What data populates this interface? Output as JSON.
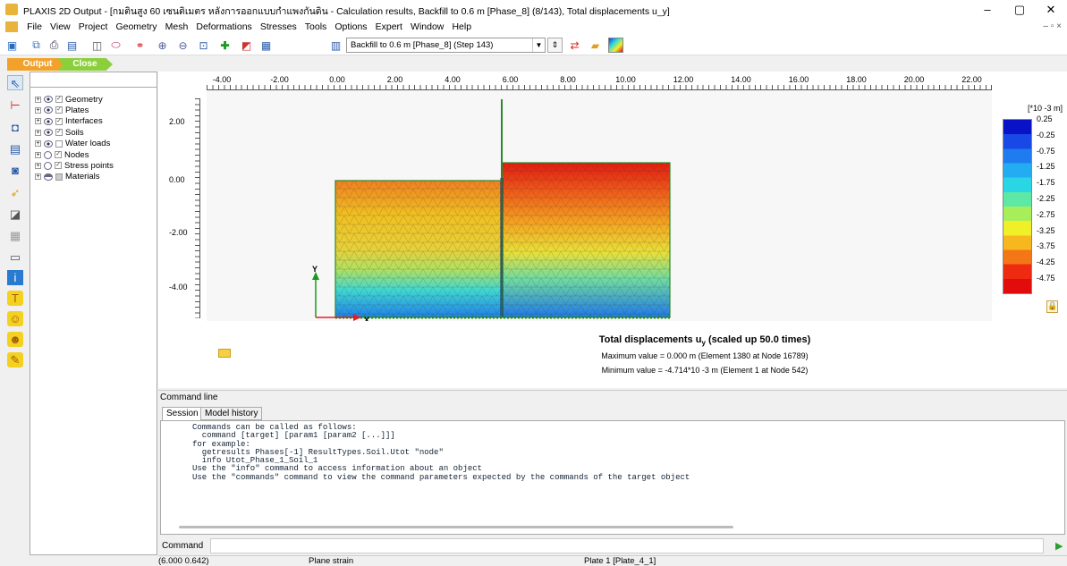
{
  "window": {
    "title": "PLAXIS 2D Output - [กมตินสูง 60 เซนติเมตร หลังการออกแบบกำแพงกันดิน - Calculation results, Backfill to 0.6 m [Phase_8] (8/143), Total displacements u_y]",
    "minimize": "–",
    "maximize": "▢",
    "close": "✕",
    "restore": "– ▫ ×"
  },
  "menu": [
    "File",
    "View",
    "Project",
    "Geometry",
    "Mesh",
    "Deformations",
    "Stresses",
    "Tools",
    "Options",
    "Expert",
    "Window",
    "Help"
  ],
  "toolbar": {
    "phase_select": "Backfill to 0.6 m [Phase_8] (Step 143)"
  },
  "mode_tabs": {
    "output": "Output",
    "close": "Close"
  },
  "tree": [
    {
      "label": "Geometry",
      "icon": "eye",
      "checked": true
    },
    {
      "label": "Plates",
      "icon": "eye",
      "checked": true
    },
    {
      "label": "Interfaces",
      "icon": "eye",
      "checked": true
    },
    {
      "label": "Soils",
      "icon": "eye",
      "checked": true
    },
    {
      "label": "Water loads",
      "icon": "eye",
      "checked": false
    },
    {
      "label": "Nodes",
      "icon": "circle",
      "checked": true
    },
    {
      "label": "Stress points",
      "icon": "circle",
      "checked": true
    },
    {
      "label": "Materials",
      "icon": "half",
      "checked": false
    }
  ],
  "plot": {
    "x_ticks": [
      "-4.00",
      "-2.00",
      "0.00",
      "2.00",
      "4.00",
      "6.00",
      "8.00",
      "10.00",
      "12.00",
      "14.00",
      "16.00",
      "18.00",
      "20.00",
      "22.00"
    ],
    "y_ticks": [
      "2.00",
      "0.00",
      "-2.00",
      "-4.00"
    ],
    "axis_x": "X",
    "axis_y": "Y"
  },
  "legend": {
    "unit": "[*10 -3 m]",
    "labels": [
      "0.25",
      "-0.25",
      "-0.75",
      "-1.25",
      "-1.75",
      "-2.25",
      "-2.75",
      "-3.25",
      "-3.75",
      "-4.25",
      "-4.75"
    ],
    "colors": [
      "#0a12c8",
      "#1848e6",
      "#1f7cf0",
      "#23acf2",
      "#2ad6e4",
      "#5ee8a6",
      "#a8ee5a",
      "#f0f028",
      "#f6b81e",
      "#f47616",
      "#ee2a10",
      "#e20c0c"
    ]
  },
  "results": {
    "title": "Total displacements u",
    "title_sub": "y",
    "title_suffix": " (scaled up 50.0 times)",
    "max": "Maximum value = 0.000 m (Element 1380 at Node 16789)",
    "min": "Minimum value = -4.714*10 -3 m (Element 1 at Node 542)"
  },
  "command": {
    "panel_label": "Command line",
    "tabs": [
      "Session",
      "Model history"
    ],
    "session_text": "Commands can be called as follows:\n  command [target] [param1 [param2 [...]]]\nfor example:\n  getresults Phases[-1] ResultTypes.Soil.Utot \"node\"\n  info Utot_Phase_1_Soil_1\nUse the \"info\" command to access information about an object\nUse the \"commands\" command to view the command parameters expected by the commands of the target object",
    "input_label": "Command",
    "input_value": ""
  },
  "status": {
    "coords": "(6.000 0.642)",
    "mode": "Plane strain",
    "selection": "Plate 1 [Plate_4_1]"
  }
}
